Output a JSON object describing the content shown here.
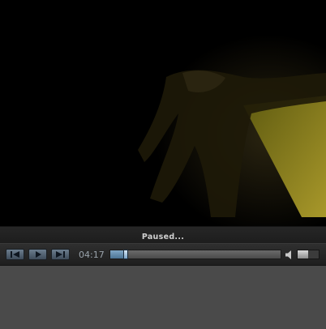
{
  "player": {
    "status": "Paused...",
    "time": "04:17",
    "progress": 0.08,
    "volume": 0.5,
    "colors": {
      "accent": "#7fa6c6",
      "video_highlight": "#b8a22b"
    }
  },
  "icons": {
    "previous": "skip-back-icon",
    "play": "play-icon",
    "next": "skip-forward-icon",
    "volume": "speaker-icon"
  }
}
